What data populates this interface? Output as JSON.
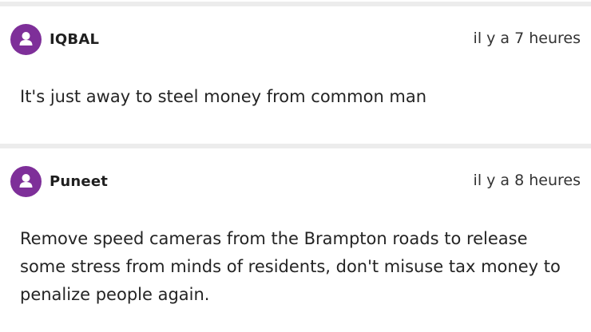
{
  "comments": [
    {
      "username": "IQBAL",
      "timestamp": "il y a 7 heures",
      "text": "It's just away to steel money from common man",
      "avatar_icon": "user-avatar-icon",
      "avatar_color": "#7e2f99"
    },
    {
      "username": "Puneet",
      "timestamp": "il y a 8 heures",
      "text": "Remove speed cameras from the Brampton roads to release some stress from minds of residents, don't misuse tax money to penalize people again.",
      "avatar_icon": "user-avatar-icon",
      "avatar_color": "#7e2f99"
    }
  ],
  "colors": {
    "divider": "#ececec",
    "avatar": "#7e2f99",
    "text": "#242424"
  }
}
